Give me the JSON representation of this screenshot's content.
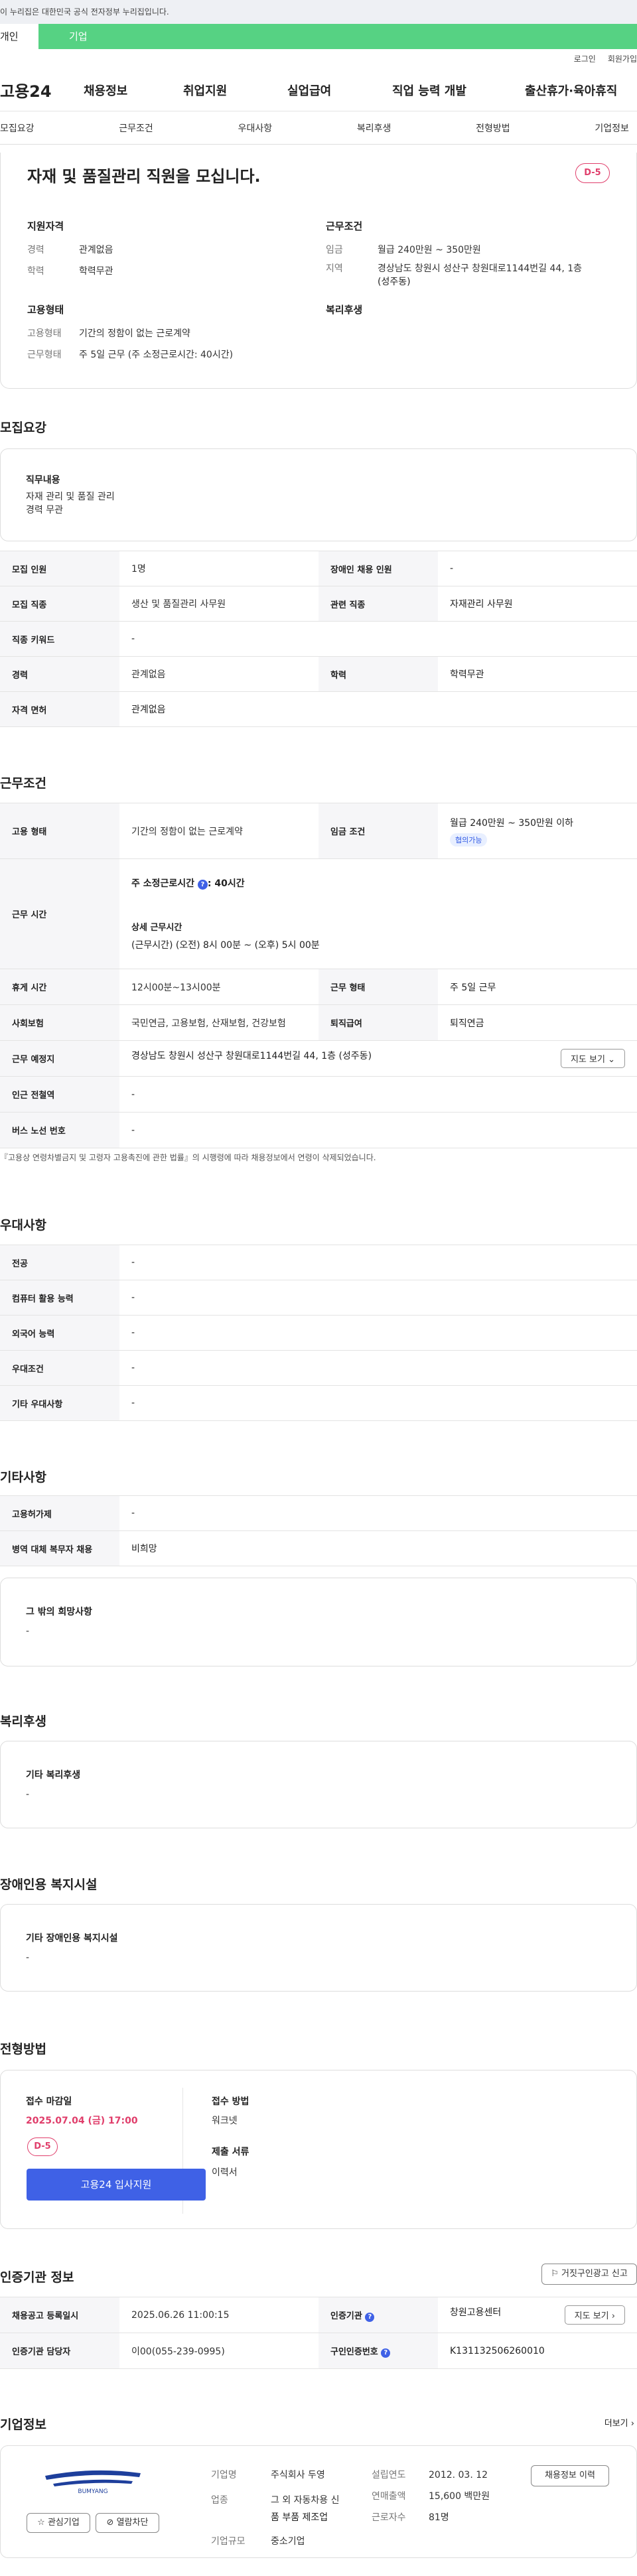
{
  "gov_banner": "이 누리집은 대한민국 공식 전자정부 누리집입니다.",
  "tabs": [
    "개인",
    "기업"
  ],
  "util": [
    "로그인",
    "회원가입"
  ],
  "logo": "고용24",
  "gnb": [
    "채용정보",
    "취업지원",
    "실업급여",
    "직업 능력 개발",
    "출산휴가·육아휴직"
  ],
  "subnav": [
    "모집요강",
    "근무조건",
    "우대사항",
    "복리후생",
    "전형방법",
    "기업정보"
  ],
  "job": {
    "title": "자재 및 품질관리 직원을 모십니다.",
    "dday": "D-5",
    "qual_h": "지원자격",
    "exp_k": "경력",
    "exp_v": "관계없음",
    "edu_k": "학력",
    "edu_v": "학력무관",
    "cond_h": "근무조건",
    "pay_k": "임금",
    "pay_v": "월급 240만원 ~ 350만원",
    "area_k": "지역",
    "area_v1": "경상남도 창원시 성산구 창원대로1144번길 44, 1층",
    "area_v2": "(성주동)",
    "emp_h": "고용형태",
    "type_k": "고용형태",
    "type_v": "기간의 정함이 없는 근로계약",
    "work_k": "근무형태",
    "work_v": "주 5일 근무 (주 소정근로시간: 40시간)",
    "welfare_h": "복리후생"
  },
  "recruit": {
    "title": "모집요강",
    "duty_h": "직무내용",
    "duty_1": "자재 관리 및 품질 관리",
    "duty_2": "경력 무관",
    "rows": [
      [
        "모집 인원",
        "1명",
        "장애인 채용 인원",
        "-"
      ],
      [
        "모집 직종",
        "생산 및 품질관리 사무원",
        "관련 직종",
        "자재관리 사무원"
      ],
      [
        "직종 키워드",
        "-",
        "",
        ""
      ],
      [
        "경력",
        "관계없음",
        "학력",
        "학력무관"
      ],
      [
        "자격 면허",
        "관계없음",
        "",
        ""
      ]
    ]
  },
  "work": {
    "title": "근무조건",
    "emp_k": "고용 형태",
    "emp_v": "기간의 정함이 없는 근로계약",
    "wage_k": "임금 조건",
    "wage_v": "월급 240만원 ~ 350만원 이하",
    "wage_badge": "협의가능",
    "hours_k": "근무 시간",
    "hours_l1": "주 소정근로시간",
    "hours_l1b": "40시간",
    "hours_l2": "상세 근무시간",
    "hours_l3": "(근무시간) (오전) 8시 00분 ~ (오후) 5시 00분",
    "rest_k": "휴게 시간",
    "rest_v": "12시00분~13시00분",
    "form_k": "근무 형태",
    "form_v": "주 5일 근무",
    "ins_k": "사회보험",
    "ins_v": "국민연금, 고용보험, 산재보험, 건강보험",
    "ret_k": "퇴직급여",
    "ret_v": "퇴직연금",
    "place_k": "근무 예정지",
    "place_v": "경상남도 창원시 성산구 창원대로1144번길 44, 1층 (성주동)",
    "map_btn": "지도 보기",
    "subway_k": "인근 전철역",
    "subway_v": "-",
    "bus_k": "버스 노선 번호",
    "bus_v": "-",
    "note": "『고용상 연령차별금지 및 고령자 고용촉진에 관한 법률』의 시행령에 따라 채용정보에서 연령이 삭제되었습니다."
  },
  "pref": {
    "title": "우대사항",
    "rows": [
      [
        "전공",
        "-"
      ],
      [
        "컴퓨터 활용 능력",
        "-"
      ],
      [
        "외국어 능력",
        "-"
      ],
      [
        "우대조건",
        "-"
      ],
      [
        "기타 우대사항",
        "-"
      ]
    ]
  },
  "etc": {
    "title": "기타사항",
    "rows": [
      [
        "고용허가제",
        "-"
      ],
      [
        "병역 대체 복무자 채용",
        "비희망"
      ]
    ],
    "other_h": "그 밖의 희망사항",
    "other_v": "-"
  },
  "welfare": {
    "title": "복리후생",
    "h": "기타 복리후생",
    "v": "-"
  },
  "disabled": {
    "title": "장애인용 복지시설",
    "h": "기타 장애인용 복지시설",
    "v": "-"
  },
  "process": {
    "title": "전형방법",
    "deadline_h": "접수 마감일",
    "deadline_v": "2025.07.04 (금) 17:00",
    "dday": "D-5",
    "apply_btn": "고용24 입사지원",
    "method_h": "접수 방법",
    "method_v": "워크넷",
    "docs_h": "제출 서류",
    "docs_v": "이력서"
  },
  "agency": {
    "title": "인증기관 정보",
    "report_btn": "거짓구인광고 신고",
    "reg_k": "채용공고 등록일시",
    "reg_v": "2025.06.26 11:00:15",
    "org_k": "인증기관",
    "org_v": "창원고용센터",
    "map_btn": "지도 보기",
    "mgr_k": "인증기관 담당자",
    "mgr_v": "이00(055-239-0995)",
    "cert_k": "구인인증번호",
    "cert_v": "K131132506260010"
  },
  "company": {
    "title": "기업정보",
    "more": "더보기",
    "logo_text": "BUMYANG",
    "name_k": "기업명",
    "name_v": "주식회사 두영",
    "biz_k": "업종",
    "biz_v1": "그 외 자동차용 신",
    "biz_v2": "품 부품 제조업",
    "size_k": "기업규모",
    "size_v": "중소기업",
    "est_k": "설립연도",
    "est_v": "2012. 03. 12",
    "sales_k": "연매출액",
    "sales_v": "15,600 백만원",
    "emp_k": "근로자수",
    "emp_v": "81명",
    "interest_btn": "관심기업",
    "block_btn": "열람차단",
    "jobs_btn": "채용정보 이력"
  },
  "colors": {
    "green": "#56d283",
    "blue": "#3f61e6",
    "pink": "#e03e6b"
  }
}
